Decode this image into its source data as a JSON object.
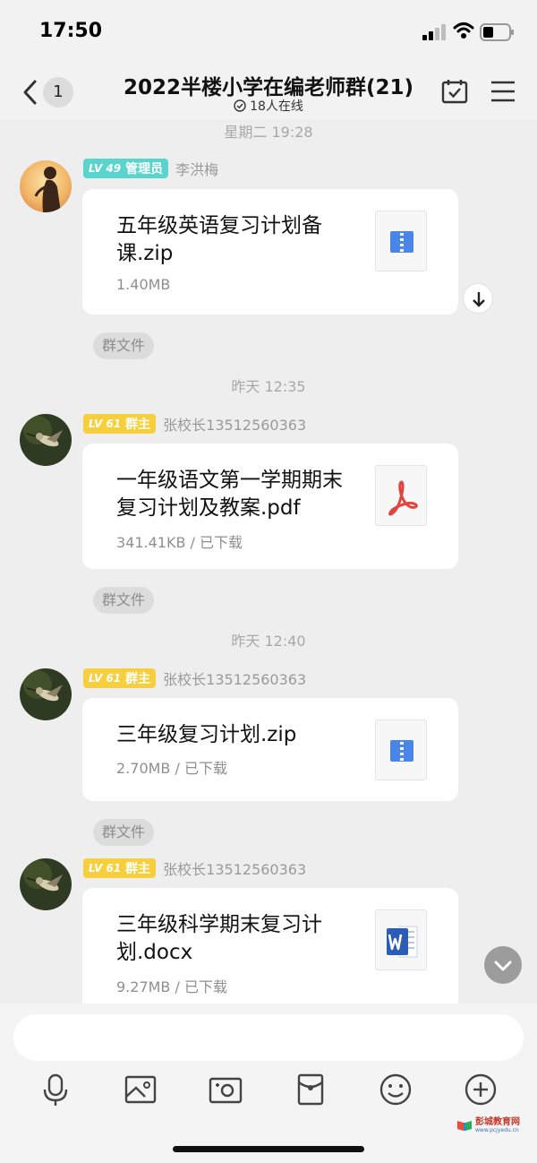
{
  "status_bar": {
    "time": "17:50"
  },
  "header": {
    "back_badge": "1",
    "title": "2022半楼小学在编老师群(21)",
    "online": "18人在线"
  },
  "messages": [
    {
      "time": "星期二 19:28",
      "level": "LV 49",
      "role": "管理员",
      "sender": "李洪梅",
      "file_name": "五年级英语复习计划备课.zip",
      "meta": "1.40MB",
      "file_type": "zip",
      "tag": "群文件"
    },
    {
      "time": "昨天 12:35",
      "level": "LV 61",
      "role": "群主",
      "sender": "张校长13512560363",
      "file_name": "一年级语文第一学期期末复习计划及教案.pdf",
      "meta": "341.41KB / 已下载",
      "file_type": "pdf",
      "tag": "群文件"
    },
    {
      "time": "昨天 12:40",
      "level": "LV 61",
      "role": "群主",
      "sender": "张校长13512560363",
      "file_name": "三年级复习计划.zip",
      "meta": "2.70MB / 已下载",
      "file_type": "zip",
      "tag": "群文件"
    },
    {
      "level": "LV 61",
      "role": "群主",
      "sender": "张校长13512560363",
      "file_name": "三年级科学期末复习计划.docx",
      "meta": "9.27MB / 已下载",
      "file_type": "docx"
    }
  ],
  "input": {
    "placeholder": ""
  },
  "toolbar": [
    "microphone-icon",
    "image-icon",
    "camera-icon",
    "red-packet-icon",
    "emoji-icon",
    "plus-icon"
  ],
  "watermark": {
    "name": "彭城教育网",
    "url": "www.pcjyedu.cn"
  },
  "colors": {
    "admin_badge": "#5ad4cc",
    "owner_badge": "#f7cf3c",
    "zip_blue": "#4a86e8",
    "pdf_red": "#e0443e",
    "word_blue": "#2b5cb8"
  }
}
